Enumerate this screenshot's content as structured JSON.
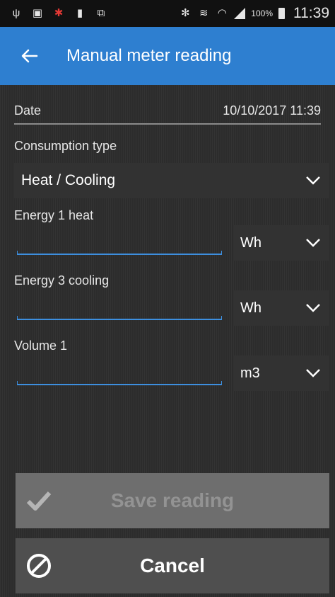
{
  "status_bar": {
    "icons": [
      "usb-icon",
      "image-icon",
      "debug-icon",
      "sd-card-icon",
      "screenshot-icon",
      "bluetooth-icon",
      "vibrate-icon",
      "wifi-icon",
      "signal-icon",
      "battery-icon"
    ],
    "battery_percent": "100%",
    "time": "11:39"
  },
  "app_bar": {
    "title": "Manual meter reading"
  },
  "form": {
    "date_label": "Date",
    "date_value": "10/10/2017 11:39",
    "consumption_type_label": "Consumption type",
    "consumption_type_value": "Heat / Cooling",
    "fields": [
      {
        "label": "Energy 1 heat",
        "value": "",
        "unit": "Wh"
      },
      {
        "label": "Energy 3 cooling",
        "value": "",
        "unit": "Wh"
      },
      {
        "label": "Volume 1",
        "value": "",
        "unit": "m3"
      }
    ]
  },
  "buttons": {
    "save_label": "Save reading",
    "cancel_label": "Cancel"
  },
  "colors": {
    "app_bar": "#2e7fd0",
    "input_underline": "#3d8fdf",
    "save_disabled": "#6e6e6e",
    "cancel_bg": "#4f4f4f"
  }
}
